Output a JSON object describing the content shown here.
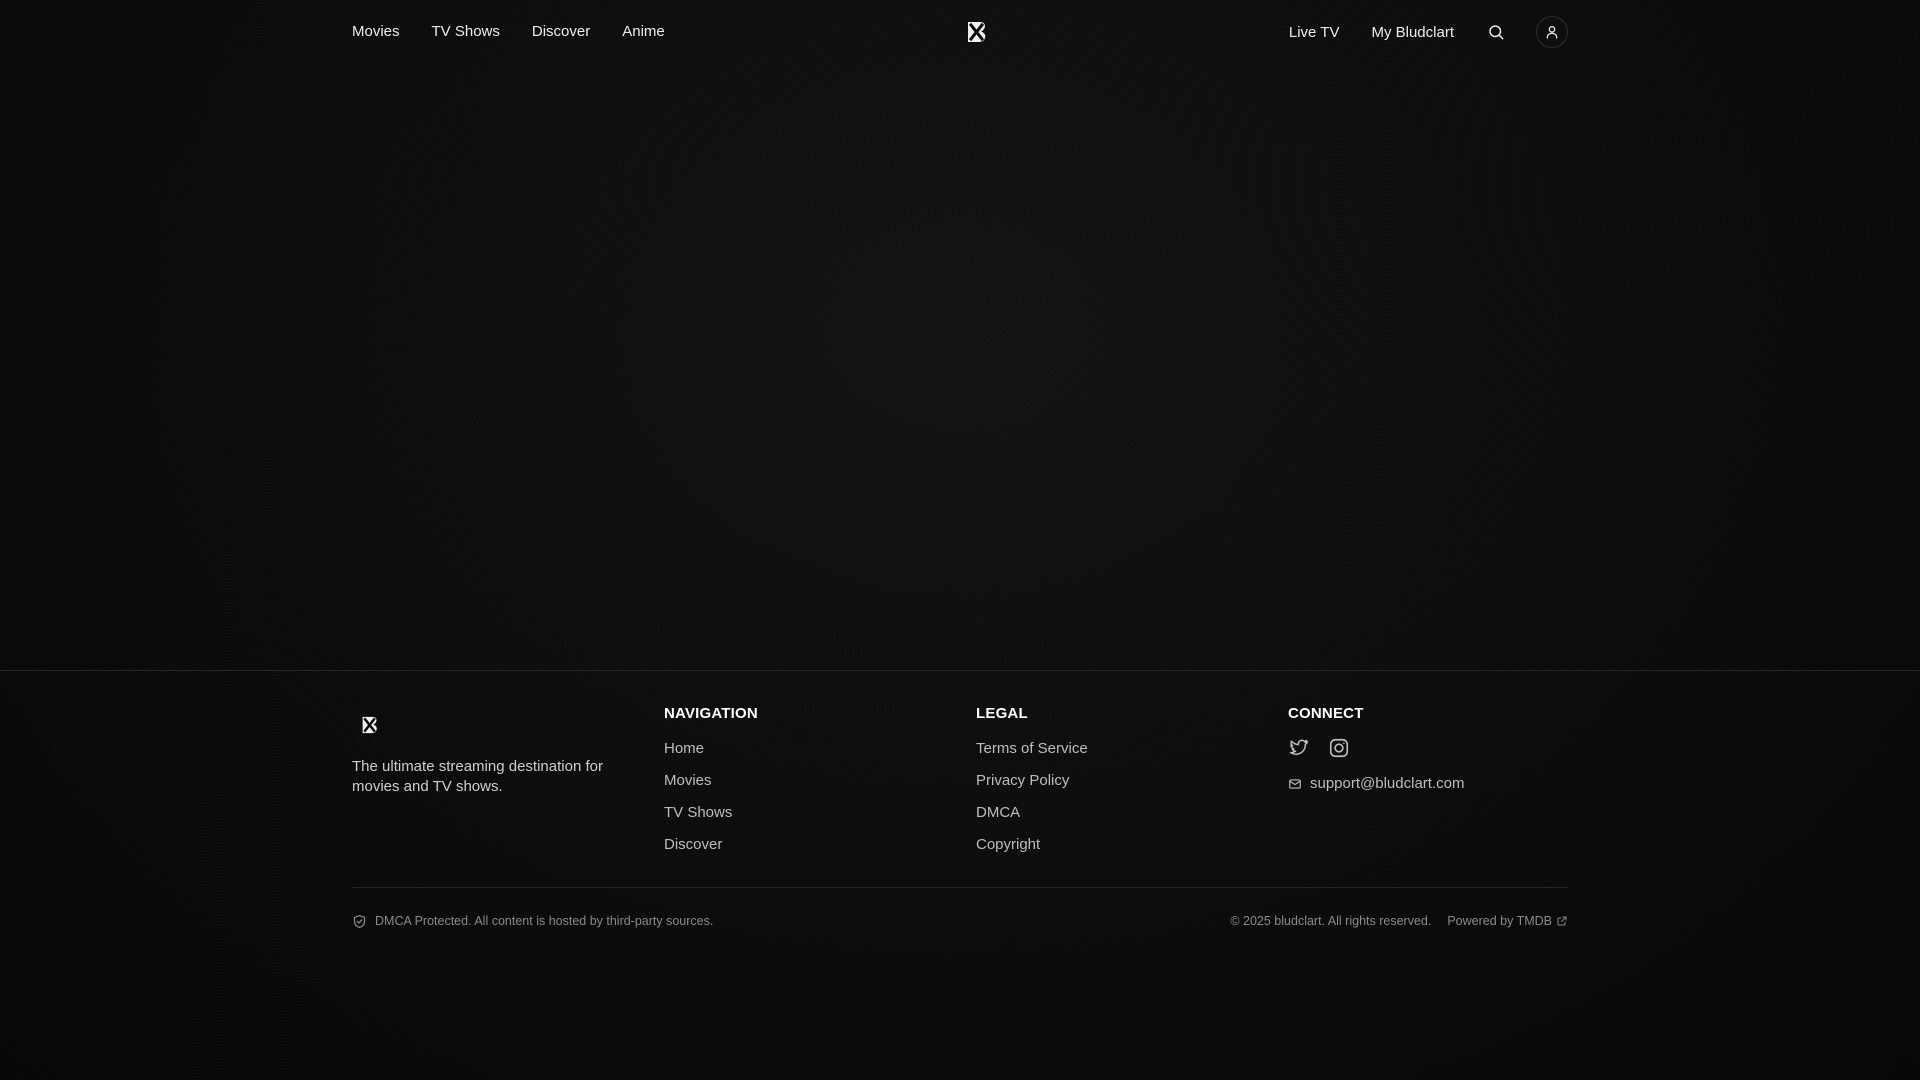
{
  "header": {
    "nav_left": [
      "Movies",
      "TV Shows",
      "Discover",
      "Anime"
    ],
    "nav_right": [
      "Live TV",
      "My Bludclart"
    ],
    "logo_icon": "bludclart-logo-icon",
    "search_icon": "search-icon",
    "account_icon": "user-icon"
  },
  "footer": {
    "tagline": "The ultimate streaming destination for movies and TV shows.",
    "navigation": {
      "title": "NAVIGATION",
      "links": [
        "Home",
        "Movies",
        "TV Shows",
        "Discover"
      ]
    },
    "legal": {
      "title": "LEGAL",
      "links": [
        "Terms of Service",
        "Privacy Policy",
        "DMCA",
        "Copyright"
      ]
    },
    "connect": {
      "title": "CONNECT",
      "social_icons": [
        "twitter-icon",
        "instagram-icon"
      ],
      "email": "support@bludclart.com"
    },
    "dmca_notice": "DMCA Protected. All content is hosted by third-party sources.",
    "copyright": "© 2025 bludclart. All rights reserved.",
    "powered_by": "Powered by TMDB"
  },
  "colors": {
    "background": "#0b0b0b",
    "text_primary": "#ffffff",
    "text_secondary": "#bdbdbd",
    "text_muted": "#8a8a8a",
    "border": "#262626"
  }
}
